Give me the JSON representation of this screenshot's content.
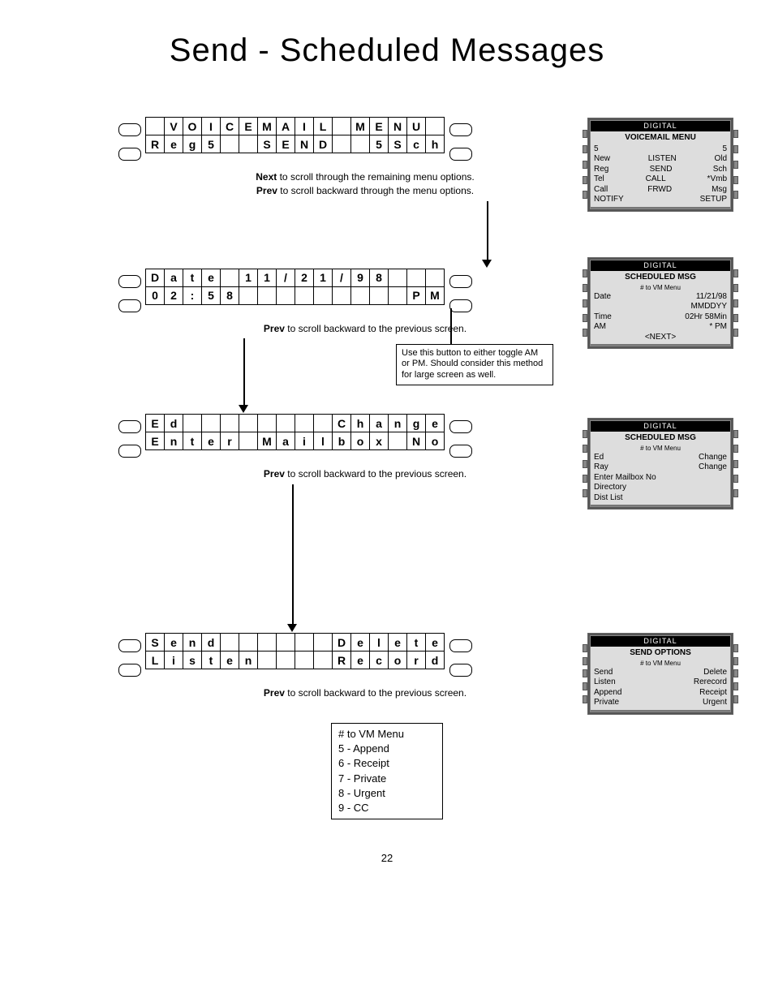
{
  "title": "Send - Scheduled Messages",
  "page_number": "22",
  "panels": [
    {
      "rows": [
        [
          " ",
          "V",
          "O",
          "I",
          "C",
          "E",
          "M",
          "A",
          "I",
          "L",
          " ",
          "M",
          "E",
          "N",
          "U",
          " "
        ],
        [
          "R",
          "e",
          "g",
          "5",
          " ",
          " ",
          "S",
          "E",
          "N",
          "D",
          " ",
          " ",
          "5",
          "S",
          "c",
          "h"
        ]
      ],
      "caption_html": "<b>Next</b> to scroll through the remaining menu options.<br><b>Prev</b> to scroll backward through the menu options."
    },
    {
      "rows": [
        [
          "D",
          "a",
          "t",
          "e",
          " ",
          "1",
          "1",
          "/",
          "2",
          "1",
          "/",
          "9",
          "8",
          " ",
          " ",
          " "
        ],
        [
          "0",
          "2",
          ":",
          "5",
          "8",
          " ",
          " ",
          " ",
          " ",
          " ",
          " ",
          " ",
          " ",
          " ",
          "P",
          "M"
        ]
      ],
      "caption_html": "<b>Prev</b> to scroll backward to the previous screen.",
      "note": "Use this button to either toggle AM or PM.  Should consider this method for large screen as well."
    },
    {
      "rows": [
        [
          "E",
          "d",
          " ",
          " ",
          " ",
          " ",
          " ",
          " ",
          " ",
          " ",
          "C",
          "h",
          "a",
          "n",
          "g",
          "e"
        ],
        [
          "E",
          "n",
          "t",
          "e",
          "r",
          " ",
          "M",
          "a",
          "i",
          "l",
          "b",
          "o",
          "x",
          " ",
          "N",
          "o"
        ]
      ],
      "caption_html": "<b>Prev</b> to scroll backward to the previous screen."
    },
    {
      "rows": [
        [
          "S",
          "e",
          "n",
          "d",
          " ",
          " ",
          " ",
          " ",
          " ",
          " ",
          "D",
          "e",
          "l",
          "e",
          "t",
          "e"
        ],
        [
          "L",
          "i",
          "s",
          "t",
          "e",
          "n",
          " ",
          " ",
          " ",
          " ",
          "R",
          "e",
          "c",
          "o",
          "r",
          "d"
        ]
      ],
      "caption_html": "<b>Prev</b> to scroll backward to the previous screen."
    }
  ],
  "options_list": [
    "#  to VM Menu",
    "5 - Append",
    "6 - Receipt",
    "7 - Private",
    "8 - Urgent",
    "9 - CC"
  ],
  "phones": [
    {
      "title": "DIGITAL",
      "head": "VOICEMAIL MENU",
      "rows": [
        [
          "5",
          "",
          "5"
        ],
        [
          "New",
          "LISTEN",
          "Old"
        ],
        [
          "Reg",
          "SEND",
          "Sch"
        ],
        [
          "Tel",
          "CALL",
          "*Vmb"
        ],
        [
          "Call",
          "FRWD",
          "Msg"
        ],
        [
          "NOTIFY",
          "",
          "SETUP"
        ]
      ]
    },
    {
      "title": "DIGITAL",
      "head": "SCHEDULED MSG",
      "sub": "# to VM Menu",
      "rows": [
        [
          "Date",
          "",
          "11/21/98"
        ],
        [
          "",
          "",
          "MMDDYY"
        ],
        [
          "Time",
          "",
          "02Hr 58Min"
        ],
        [
          "AM",
          "",
          "* PM"
        ],
        [
          "",
          "<NEXT>",
          ""
        ]
      ]
    },
    {
      "title": "DIGITAL",
      "head": "SCHEDULED MSG",
      "sub": "# to VM Menu",
      "rows": [
        [
          "Ed",
          "",
          "Change"
        ],
        [
          "Ray",
          "",
          "Change"
        ],
        [
          "Enter Mailbox No",
          "",
          ""
        ],
        [
          "Directory",
          "",
          ""
        ],
        [
          "Dist List",
          "",
          ""
        ]
      ]
    },
    {
      "title": "DIGITAL",
      "head": "SEND OPTIONS",
      "sub": "# to VM Menu",
      "rows": [
        [
          "Send",
          "",
          "Delete"
        ],
        [
          "Listen",
          "",
          "Rerecord"
        ],
        [
          "Append",
          "",
          "Receipt"
        ],
        [
          "Private",
          "",
          "Urgent"
        ]
      ]
    }
  ]
}
